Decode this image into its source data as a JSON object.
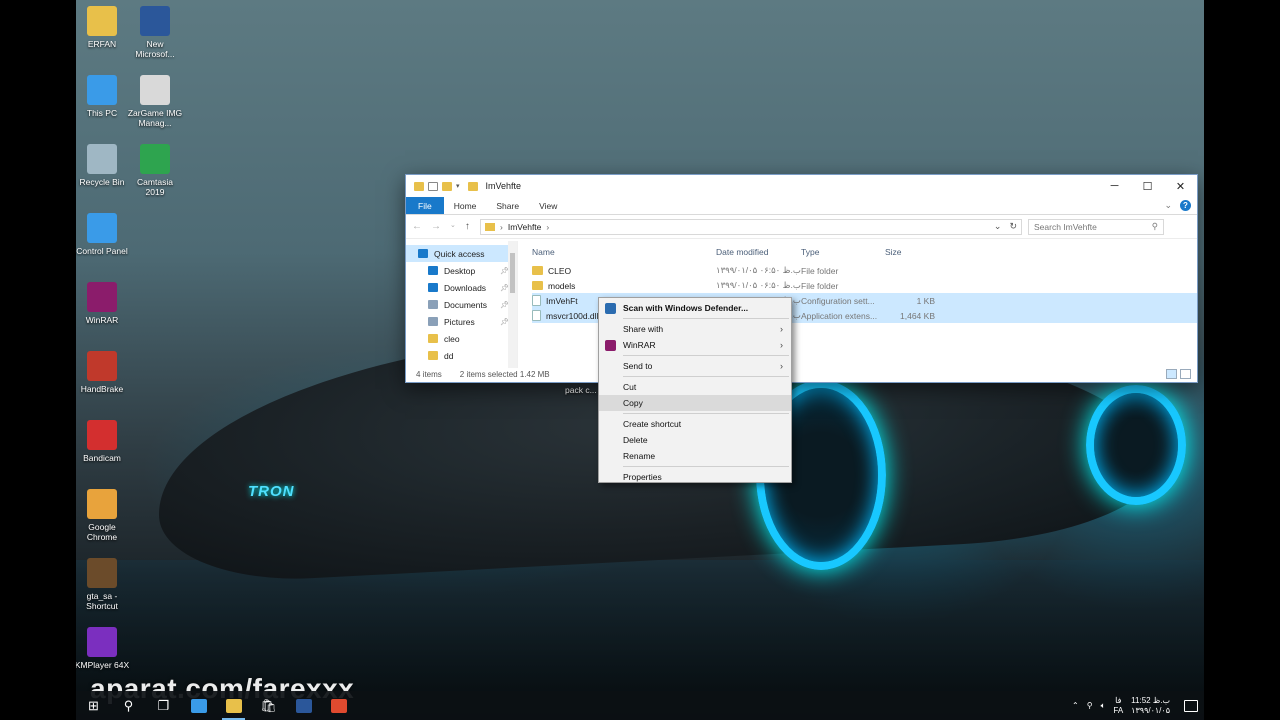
{
  "desktop": {
    "icons": [
      {
        "label": "ERFAN",
        "icon": "user-folder-icon",
        "color": "#e8c04a"
      },
      {
        "label": "New Microsof...",
        "icon": "word-doc-icon",
        "color": "#2b579a"
      },
      {
        "label": "This PC",
        "icon": "computer-icon",
        "color": "#3a9be8"
      },
      {
        "label": "ZarGame IMG Manag...",
        "icon": "img-manager-icon",
        "color": "#d9d9d9"
      },
      {
        "label": "Recycle Bin",
        "icon": "recycle-bin-icon",
        "color": "#9fb7c4"
      },
      {
        "label": "Camtasia 2019",
        "icon": "camtasia-icon",
        "color": "#2ea44f"
      },
      {
        "label": "Control Panel",
        "icon": "control-panel-icon",
        "color": "#3a9be8"
      },
      {
        "label": "WinRAR",
        "icon": "winrar-icon",
        "color": "#8b1c6b"
      },
      {
        "label": "HandBrake",
        "icon": "handbrake-icon",
        "color": "#c0392b"
      },
      {
        "label": "Bandicam",
        "icon": "bandicam-icon",
        "color": "#d32f2f"
      },
      {
        "label": "Google Chrome",
        "icon": "chrome-icon",
        "color": "#e8a33c"
      },
      {
        "label": "gta_sa - Shortcut",
        "icon": "gta-icon",
        "color": "#6b4b2a"
      },
      {
        "label": "KMPlayer 64X",
        "icon": "kmplayer-icon",
        "color": "#7b2fbf"
      }
    ],
    "tron_label": "TRON",
    "pack_label": "pack c..."
  },
  "explorer": {
    "title": "ImVehfte",
    "tabs": {
      "file": "File",
      "home": "Home",
      "share": "Share",
      "view": "View"
    },
    "address": {
      "path_item": "ImVehfte"
    },
    "search": {
      "placeholder": "Search ImVehfte"
    },
    "columns": {
      "name": "Name",
      "date": "Date modified",
      "type": "Type",
      "size": "Size"
    },
    "nav": [
      {
        "label": "Quick access",
        "icon": "star-icon",
        "color": "#1979ca",
        "pinned": false,
        "selected": true
      },
      {
        "label": "Desktop",
        "icon": "desktop-folder-icon",
        "color": "#1979ca",
        "pinned": true
      },
      {
        "label": "Downloads",
        "icon": "downloads-icon",
        "color": "#1979ca",
        "pinned": true
      },
      {
        "label": "Documents",
        "icon": "documents-icon",
        "color": "#8aa0b8",
        "pinned": true
      },
      {
        "label": "Pictures",
        "icon": "pictures-icon",
        "color": "#8aa0b8",
        "pinned": true
      },
      {
        "label": "cleo",
        "icon": "folder-icon",
        "color": "#e8c04a",
        "pinned": false
      },
      {
        "label": "dd",
        "icon": "folder-icon",
        "color": "#e8c04a",
        "pinned": false
      }
    ],
    "files": [
      {
        "name": "CLEO",
        "date": "۱۳۹۹/۰۱/۰۵ ب.ظ ۰۶:۵۰",
        "type": "File folder",
        "size": "",
        "kind": "folder",
        "selected": false
      },
      {
        "name": "models",
        "date": "۱۳۹۹/۰۱/۰۵ ب.ظ ۰۶:۵۰",
        "type": "File folder",
        "size": "",
        "kind": "folder",
        "selected": false
      },
      {
        "name": "ImVehFt",
        "date": "۱۳۹۹/۰۱/۰۵ ب.ظ ۰۶:۵۰",
        "type": "Configuration sett...",
        "size": "1 KB",
        "kind": "doc",
        "selected": true
      },
      {
        "name": "msvcr100d.dll",
        "date": "۱۳۹۹/۰۱/۰۵ ب.ظ ۰۶:۵۰",
        "type": "Application extens...",
        "size": "1,464 KB",
        "kind": "doc",
        "selected": true
      }
    ],
    "status": {
      "items": "4 items",
      "selected": "2 items selected  1.42 MB"
    }
  },
  "context_menu": {
    "items": [
      {
        "label": "Scan with Windows Defender...",
        "icon": "defender-icon",
        "bold": true,
        "submenu": false,
        "sep_after": true
      },
      {
        "label": "Share with",
        "submenu": true
      },
      {
        "label": "WinRAR",
        "icon": "winrar-icon",
        "submenu": true,
        "sep_after": true
      },
      {
        "label": "Send to",
        "submenu": true,
        "sep_after": true
      },
      {
        "label": "Cut"
      },
      {
        "label": "Copy",
        "hover": true,
        "sep_after": true
      },
      {
        "label": "Create shortcut"
      },
      {
        "label": "Delete"
      },
      {
        "label": "Rename",
        "sep_after": true
      },
      {
        "label": "Properties"
      }
    ]
  },
  "watermark": "aparat.com/farexxx",
  "taskbar": {
    "apps": [
      {
        "name": "start-button",
        "icon": "windows-icon",
        "color": "#ffffff"
      },
      {
        "name": "search-button",
        "icon": "search-icon",
        "color": "#ffffff"
      },
      {
        "name": "task-view-button",
        "icon": "task-view-icon",
        "color": "#ffffff"
      },
      {
        "name": "edge-button",
        "icon": "edge-icon",
        "color": "#3a9be8"
      },
      {
        "name": "file-explorer-button",
        "icon": "file-explorer-icon",
        "color": "#e8c04a",
        "active": true
      },
      {
        "name": "store-button",
        "icon": "store-icon",
        "color": "#ffffff"
      },
      {
        "name": "word-button",
        "icon": "word-icon",
        "color": "#2b579a"
      },
      {
        "name": "camtasia-button",
        "icon": "camtasia-recorder-icon",
        "color": "#e04a2f"
      }
    ],
    "lang": "FA",
    "lang_top": "فا",
    "time": "11:52 ب.ظ",
    "date": "۱۳۹۹/۰۱/۰۵"
  }
}
